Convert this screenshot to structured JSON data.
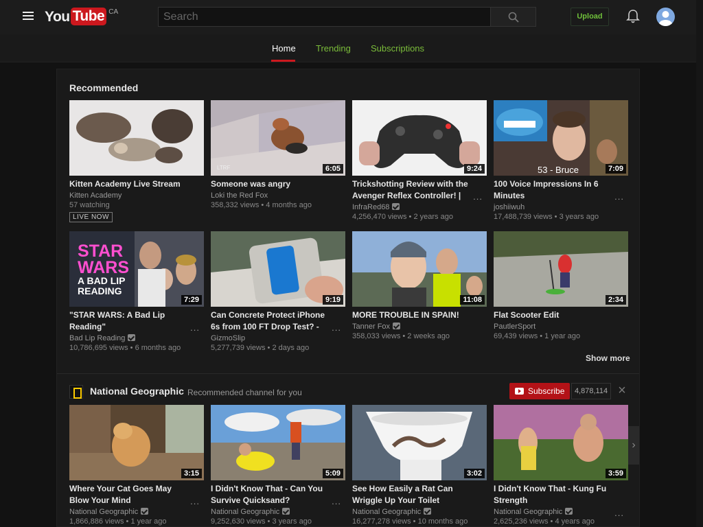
{
  "masthead": {
    "logo_you": "You",
    "logo_tube": "Tube",
    "region": "CA",
    "search_placeholder": "Search",
    "upload_label": "Upload"
  },
  "tabs": [
    {
      "label": "Home",
      "active": true
    },
    {
      "label": "Trending",
      "active": false
    },
    {
      "label": "Subscriptions",
      "active": false
    }
  ],
  "recommended": {
    "title": "Recommended",
    "show_more": "Show more",
    "videos": [
      {
        "title": "Kitten Academy Live Stream",
        "channel": "Kitten Academy",
        "meta": "57 watching",
        "badge": "LIVE NOW"
      },
      {
        "title": "Someone was angry",
        "channel": "Loki the Red Fox",
        "meta": "358,332 views  •  4 months ago",
        "duration": "6:05",
        "thumb_text": "LTRF"
      },
      {
        "title": "Trickshotting Review with the Avenger Reflex Controller! |",
        "channel": "InfraRed68",
        "verified": true,
        "meta": "4,256,470 views  •  2 years ago",
        "duration": "9:24"
      },
      {
        "title": "100 Voice Impressions In 6 Minutes",
        "channel": "joshiiwuh",
        "meta": "17,488,739 views  •  3 years ago",
        "duration": "7:09",
        "thumb_text": "53 - Bruce"
      },
      {
        "title": "\"STAR WARS: A Bad Lip Reading\"",
        "channel": "Bad Lip Reading",
        "verified": true,
        "meta": "10,786,695 views  •  6 months ago",
        "duration": "7:29",
        "thumb_text": [
          "STAR",
          "WARS",
          "A BAD LIP",
          "READING"
        ]
      },
      {
        "title": "Can Concrete Protect iPhone 6s from 100 FT Drop Test? -",
        "channel": "GizmoSlip",
        "meta": "5,277,739 views  •  2 days ago",
        "duration": "9:19"
      },
      {
        "title": "MORE TROUBLE IN SPAIN!",
        "channel": "Tanner Fox",
        "verified": true,
        "meta": "358,033 views  •  2 weeks ago",
        "duration": "11:08"
      },
      {
        "title": "Flat Scooter Edit",
        "channel": "PautlerSport",
        "meta": "69,439 views  •  1 year ago",
        "duration": "2:34"
      }
    ]
  },
  "channel_shelf": {
    "name": "National Geographic",
    "subtitle": "Recommended channel for you",
    "subscribe_label": "Subscribe",
    "subscriber_count": "4,878,114",
    "videos": [
      {
        "title": "Where Your Cat Goes May Blow Your Mind",
        "channel": "National Geographic",
        "verified": true,
        "meta": "1,866,886 views  •  1 year ago",
        "duration": "3:15"
      },
      {
        "title": "I Didn't Know That - Can You Survive Quicksand?",
        "channel": "National Geographic",
        "verified": true,
        "meta": "9,252,630 views  •  3 years ago",
        "duration": "5:09"
      },
      {
        "title": "See How Easily a Rat Can Wriggle Up Your Toilet",
        "channel": "National Geographic",
        "verified": true,
        "meta": "16,277,278 views  •  10 months ago",
        "duration": "3:02"
      },
      {
        "title": "I Didn't Know That - Kung Fu Strength",
        "channel": "National Geographic",
        "verified": true,
        "meta": "2,625,236 views  •  4 years ago",
        "duration": "3:59"
      }
    ]
  },
  "colors": {
    "accent": "#cc181e",
    "link": "#7bbd3a",
    "background": "#121212"
  }
}
